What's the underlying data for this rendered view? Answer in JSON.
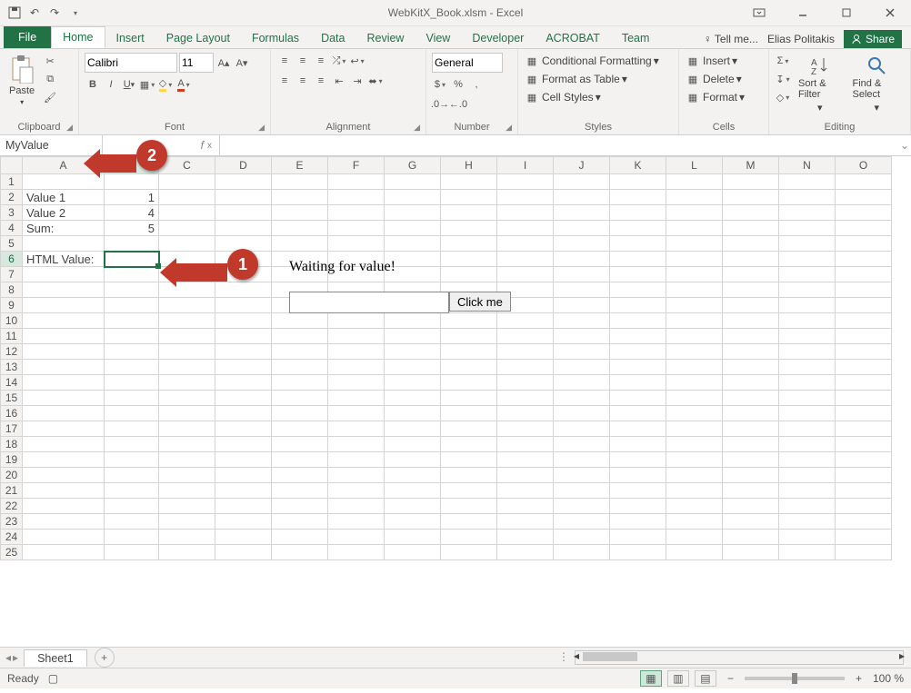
{
  "title": "WebKitX_Book.xlsm - Excel",
  "account": "Elias Politakis",
  "tell_me": "Tell me...",
  "share": "Share",
  "tabs": {
    "file": "File",
    "home": "Home",
    "insert": "Insert",
    "page_layout": "Page Layout",
    "formulas": "Formulas",
    "data": "Data",
    "review": "Review",
    "view": "View",
    "developer": "Developer",
    "acrobat": "ACROBAT",
    "team": "Team"
  },
  "ribbon": {
    "clipboard": {
      "label": "Clipboard",
      "paste": "Paste"
    },
    "font": {
      "label": "Font",
      "name": "Calibri",
      "size": "11"
    },
    "alignment": {
      "label": "Alignment"
    },
    "number": {
      "label": "Number",
      "format": "General"
    },
    "styles": {
      "label": "Styles",
      "cond": "Conditional Formatting",
      "table": "Format as Table",
      "cell": "Cell Styles"
    },
    "cells": {
      "label": "Cells",
      "insert": "Insert",
      "delete": "Delete",
      "format": "Format"
    },
    "editing": {
      "label": "Editing",
      "sort": "Sort & Filter",
      "find": "Find & Select"
    }
  },
  "name_box": "MyValue",
  "formula": "",
  "columns": [
    "A",
    "B",
    "C",
    "D",
    "E",
    "F",
    "G",
    "H",
    "I",
    "J",
    "K",
    "L",
    "M",
    "N",
    "O"
  ],
  "rows": {
    "1": {
      "A": "",
      "B": ""
    },
    "2": {
      "A": "Value 1",
      "B": "1"
    },
    "3": {
      "A": "Value 2",
      "B": "4"
    },
    "4": {
      "A": "Sum:",
      "B": "5"
    },
    "5": {
      "A": "",
      "B": ""
    },
    "6": {
      "A": "HTML Value:",
      "B": ""
    }
  },
  "row_count": 25,
  "selected_cell": "B6",
  "overlay": {
    "html_text": "Waiting for value!",
    "html_button": "Click me"
  },
  "callouts": {
    "c1": "1",
    "c2": "2"
  },
  "sheet_tab": "Sheet1",
  "status": {
    "ready": "Ready",
    "zoom": "100 %"
  }
}
